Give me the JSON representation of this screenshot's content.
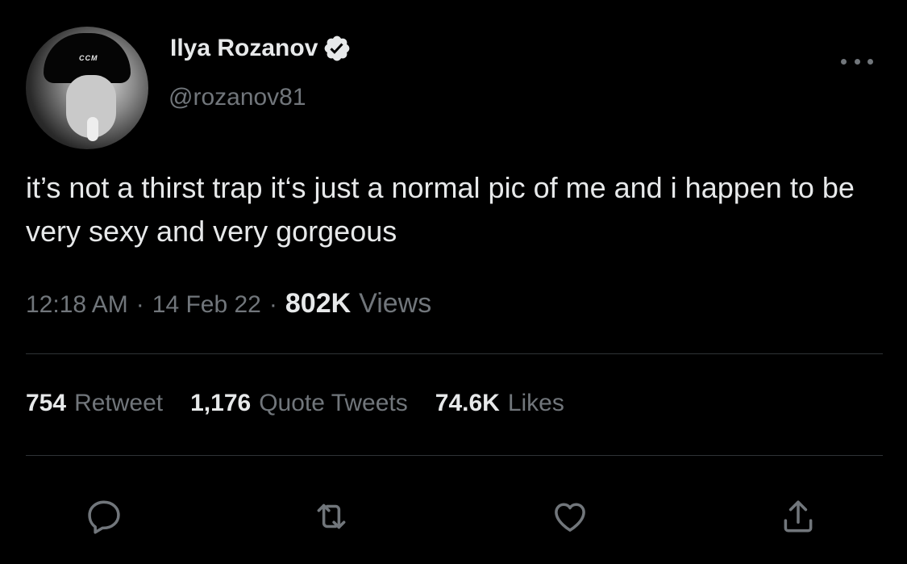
{
  "author": {
    "display_name": "Ilya Rozanov",
    "handle": "@rozanov81",
    "avatar_helmet_text": "CCM",
    "verified_icon": "verified-badge-icon"
  },
  "tweet": {
    "text": "it’s not a thirst trap it‘s just a normal pic of me and i happen to be very sexy and very gorgeous"
  },
  "meta": {
    "time": "12:18 AM",
    "separator": "·",
    "date": "14 Feb 22",
    "views_count": "802K",
    "views_label": "Views"
  },
  "stats": [
    {
      "count": "754",
      "label": "Retweet"
    },
    {
      "count": "1,176",
      "label": "Quote Tweets"
    },
    {
      "count": "74.6K",
      "label": "Likes"
    }
  ],
  "actions": [
    "reply-icon",
    "retweet-icon",
    "like-icon",
    "share-icon"
  ],
  "colors": {
    "background": "#000000",
    "primary_text": "#e7e9ea",
    "secondary_text": "#71767b",
    "divider": "#2f3336"
  }
}
